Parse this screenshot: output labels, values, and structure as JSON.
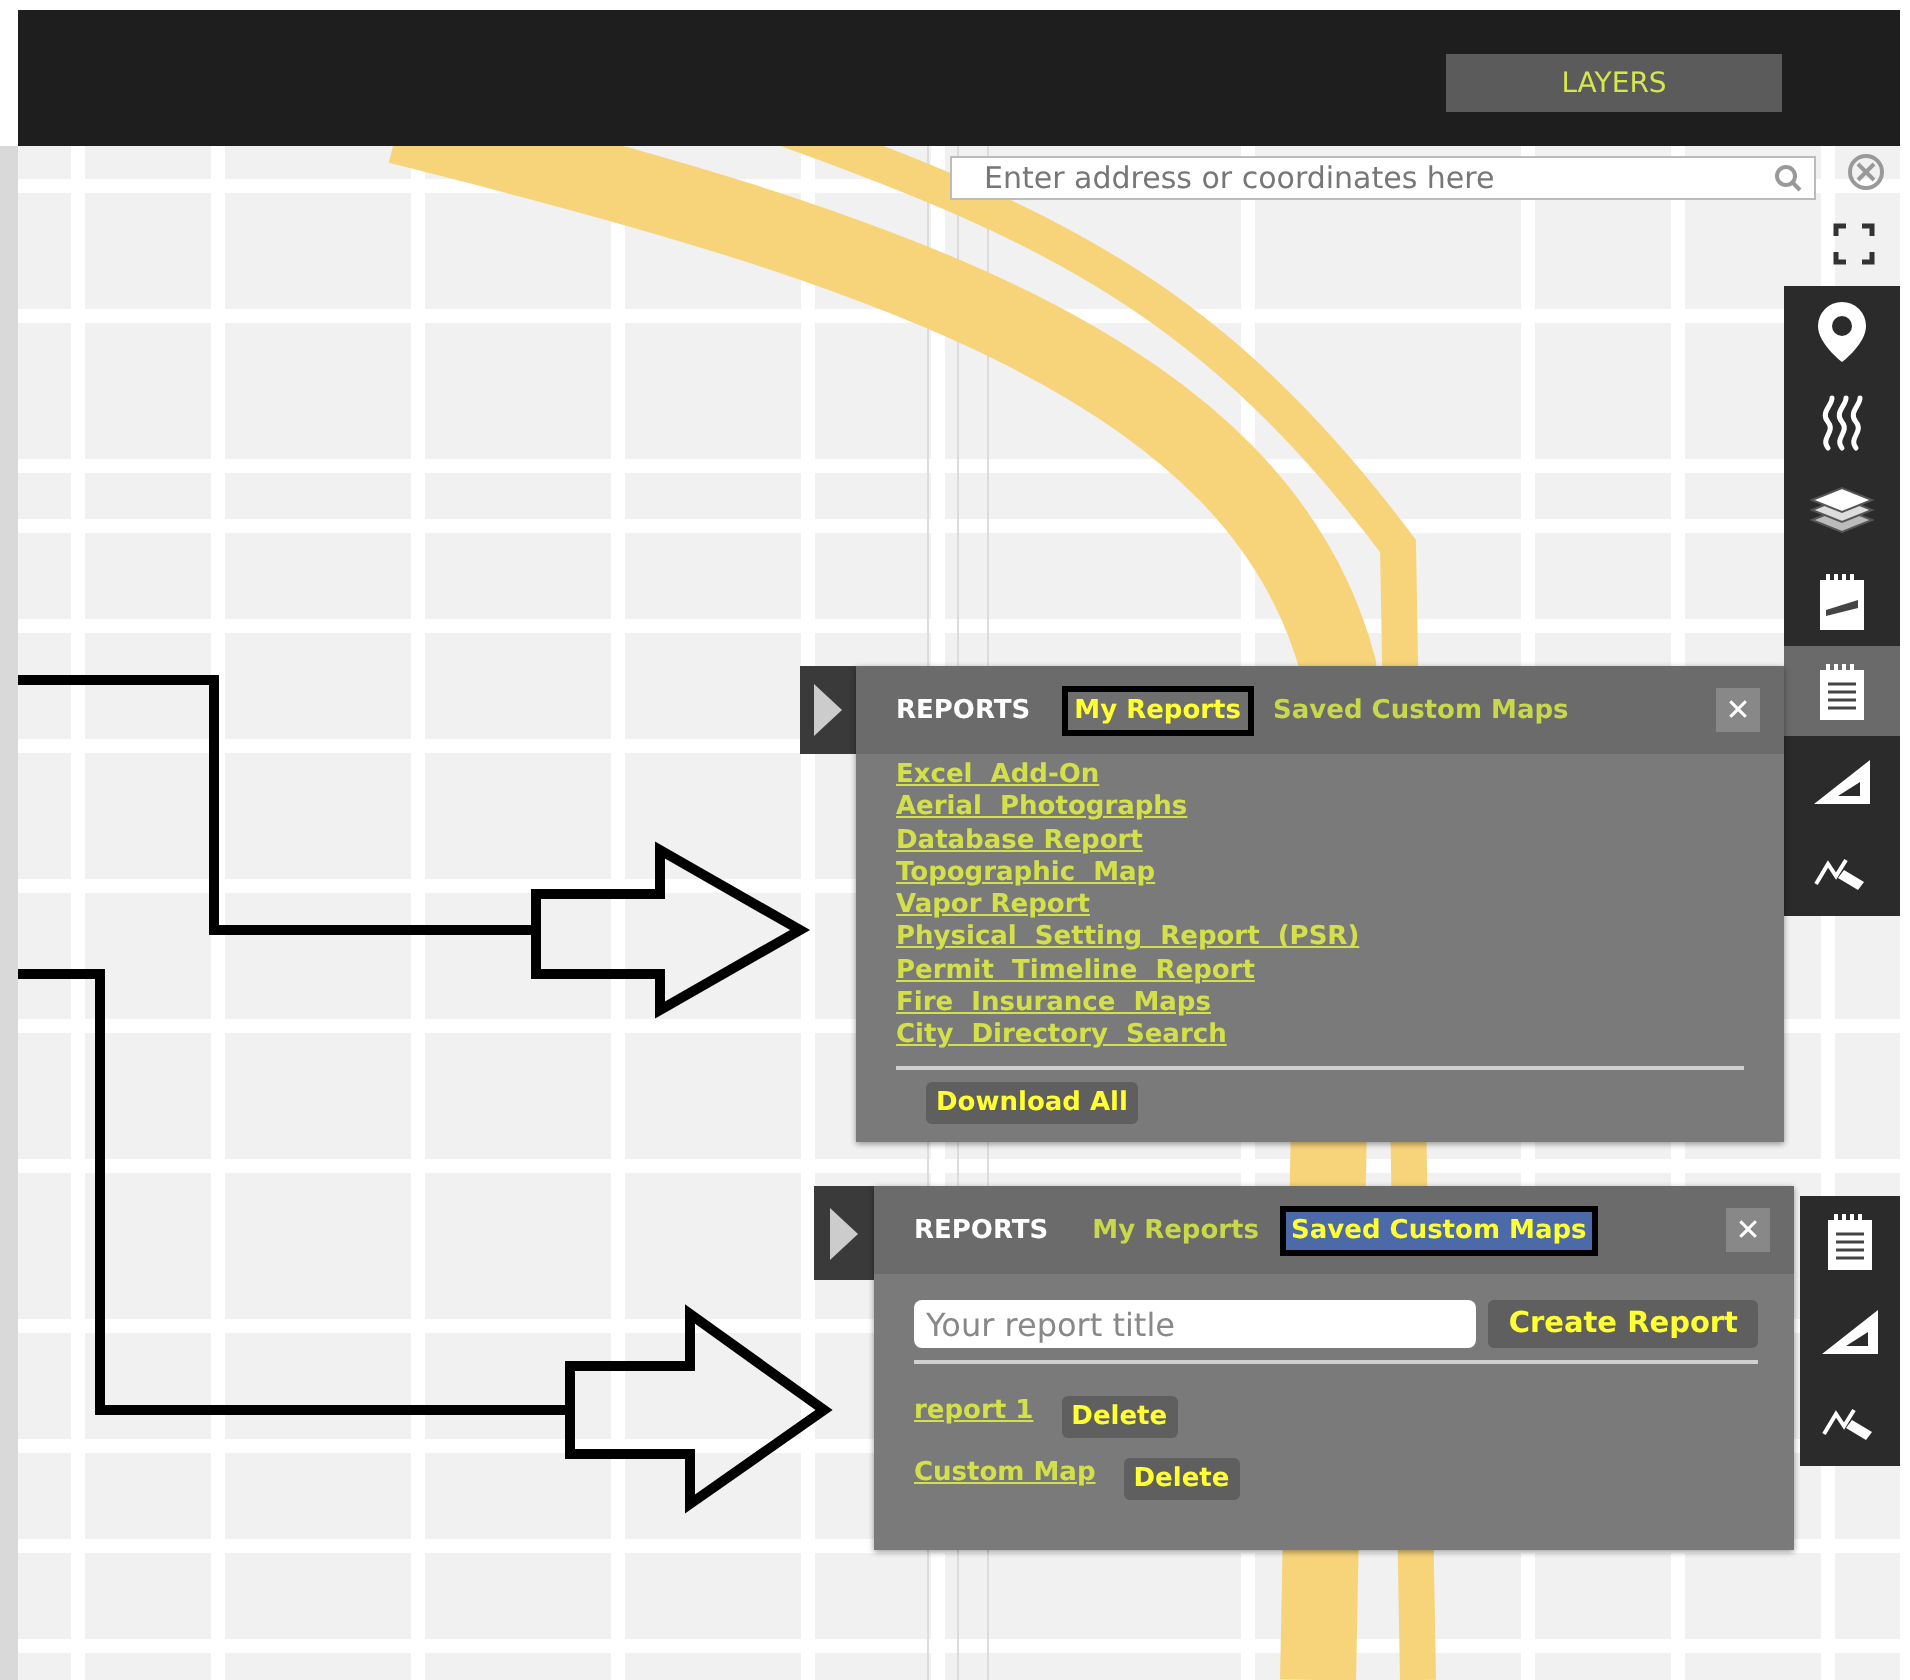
{
  "header": {
    "layers_button": "LAYERS"
  },
  "search": {
    "placeholder": "Enter address or coordinates here"
  },
  "toolbar": {
    "items": [
      {
        "kind": "pin",
        "selected": false
      },
      {
        "kind": "heat",
        "selected": false
      },
      {
        "kind": "layers",
        "selected": false
      },
      {
        "kind": "stamp",
        "selected": false
      },
      {
        "kind": "notepad",
        "selected": true
      },
      {
        "kind": "ruler",
        "selected": false
      },
      {
        "kind": "pen",
        "selected": false
      }
    ]
  },
  "toolbar_lower": {
    "items": [
      {
        "kind": "notepad",
        "selected": false
      },
      {
        "kind": "ruler",
        "selected": false
      },
      {
        "kind": "pen",
        "selected": false
      }
    ]
  },
  "report_panels": [
    {
      "kind": "list",
      "title": "REPORTS",
      "close": "✕",
      "tabs": [
        {
          "label": "My Reports",
          "selected": true
        },
        {
          "label": "Saved Custom Maps",
          "selected": false
        }
      ],
      "links": [
        "Excel  Add-On",
        "Aerial  Photographs",
        "Database Report",
        "Topographic  Map",
        "Vapor Report",
        "Physical  Setting  Report  (PSR)",
        "Permit  Timeline  Report",
        "Fire  Insurance  Maps",
        "City  Directory  Search"
      ],
      "download_button": "Download All"
    },
    {
      "kind": "saved",
      "title": "REPORTS",
      "close": "✕",
      "tabs": [
        {
          "label": "My Reports",
          "selected": false
        },
        {
          "label": "Saved Custom Maps",
          "selected": true
        }
      ],
      "title_field": {
        "placeholder": "Your report title"
      },
      "create_button": "Create Report",
      "saved": [
        {
          "name": "report 1",
          "delete": "Delete"
        },
        {
          "name": "Custom Map",
          "delete": "Delete"
        }
      ]
    }
  ]
}
